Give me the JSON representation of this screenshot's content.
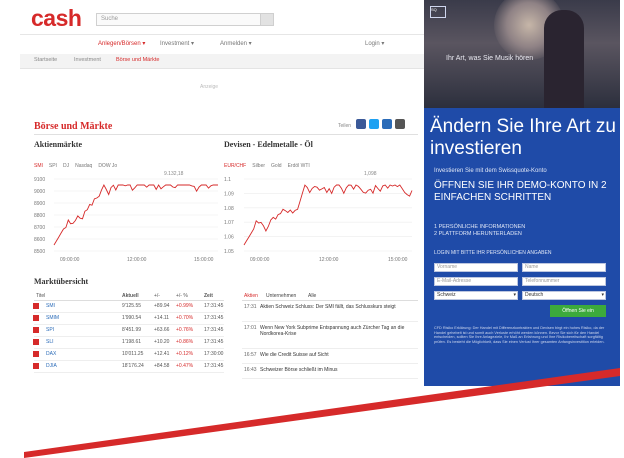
{
  "header": {
    "logo": "cash",
    "search_placeholder": "Suche",
    "nav": [
      "Anlegen/Börsen ▾",
      "Investment ▾",
      "Anmelden ▾",
      "Login ▾"
    ]
  },
  "breadcrumb": [
    "Startseite",
    "Investment",
    "Börse und Märkte"
  ],
  "ad_label": "Anzeige",
  "section": {
    "title": "Börse und Märkte",
    "share_label": "Teilen"
  },
  "charts": {
    "left": {
      "title": "Aktienmärkte",
      "tabs": [
        "SMI",
        "SPI",
        "DJ",
        "Nasdaq",
        "DOW Jo"
      ],
      "active": "SMI",
      "ylabels": [
        "9100",
        "9000",
        "8900",
        "8800",
        "8700",
        "8600",
        "8500"
      ],
      "xlabels": [
        "09:00:00",
        "12:00:00",
        "15:00:00"
      ],
      "annotation": "9.132,18"
    },
    "right": {
      "title": "Devisen - Edelmetalle - Öl",
      "tabs": [
        "EUR/CHF",
        "Silber",
        "Gold",
        "Erdöl WTI"
      ],
      "active": "EUR/CHF",
      "ylabels": [
        "1.1",
        "1.09",
        "1.08",
        "1.07",
        "1.06",
        "1.05"
      ],
      "xlabels": [
        "09:00:00",
        "12:00:00",
        "15:00:00"
      ],
      "annotation": "1,098"
    }
  },
  "market": {
    "title": "Marktübersicht",
    "columns": [
      "Titel",
      "Aktuell",
      "+/-",
      "+/- %",
      "Zeit"
    ],
    "rows": [
      [
        "SMI",
        "9'125.55",
        "+89.94",
        "+0.99%",
        "17:31:45"
      ],
      [
        "SMIM",
        "1'990.54",
        "+14.11",
        "+0.70%",
        "17:31:45"
      ],
      [
        "SPI",
        "8'451.99",
        "+63.66",
        "+0.76%",
        "17:31:45"
      ],
      [
        "SLI",
        "1'198.61",
        "+10.20",
        "+0.86%",
        "17:31:45"
      ],
      [
        "DAX",
        "10'011.25",
        "+12.41",
        "+0.12%",
        "17:30:00"
      ],
      [
        "DJIA",
        "18'176.24",
        "+84.58",
        "+0.47%",
        "17:31:45"
      ]
    ]
  },
  "news": {
    "tabs": [
      "Aktien",
      "Unternehmen",
      "Alle"
    ],
    "items": [
      {
        "time": "17:31",
        "headline": "Aktien Schweiz Schluss: Der SMI fällt, das Schlusskurs steigt"
      },
      {
        "time": "17:01",
        "headline": "Wenn New York Subprime Entspannung auch Zürcher Tag an die Nordkorea-Krise"
      },
      {
        "time": "16:57",
        "headline": "Wie die Credit Suisse auf Sicht"
      },
      {
        "time": "16:43",
        "headline": "Schweizer Börse schließt im Minus"
      }
    ]
  },
  "ad": {
    "photo_caption": "Ihr Art, was Sie Musik hören",
    "brand": "SQ",
    "headline": "Ändern Sie Ihre Art zu investieren",
    "subline": "Investieren Sie mit dem Swissquote-Konto",
    "cta": "ÖFFNEN SIE IHR DEMO-KONTO IN 2 EINFACHEN SCHRITTEN",
    "steps": "1 PERSÖNLICHE INFORMATIONEN\n2 PLATTFORM HERUNTERLADEN",
    "form_label": "LOGIN MIT BITTE IHR PERSÖNLICHEN ANGABEN",
    "fields": [
      "Vorname",
      "Name",
      "E-Mail-Adresse",
      "Telefonnummer",
      "Schweiz",
      "Deutsch"
    ],
    "button": "Öffnen Sie ein",
    "disclaimer": "CFD Risiko Erklärung: Der Handel mit Differenzkontrakten und Devisen birgt ein hohes Risiko, da der Handel gehebelt ist und somit auch Verluste erhöht werden können. Bevor Sie sich für den Handel entscheiden, sollten Sie Ihre Anlageziele, Ihr Maß an Erfahrung und Ihre Risikobereitschaft sorgfältig prüfen. Es besteht die Möglichkeit, dass Sie einen Verlust Ihrer gesamten Anfangsinvestition erleiden."
  },
  "colors": {
    "brand_red": "#d62a2a",
    "ad_blue": "#1f4ba8",
    "button_green": "#3caa3c"
  }
}
